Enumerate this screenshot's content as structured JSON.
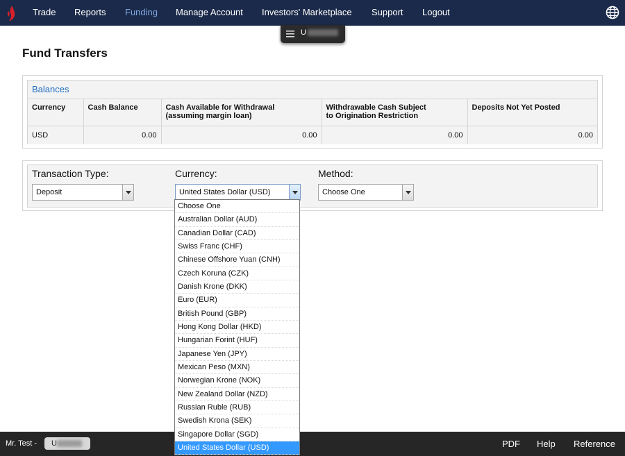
{
  "nav": {
    "items": [
      {
        "label": "Trade"
      },
      {
        "label": "Reports"
      },
      {
        "label": "Funding"
      },
      {
        "label": "Manage Account"
      },
      {
        "label": "Investors' Marketplace"
      },
      {
        "label": "Support"
      },
      {
        "label": "Logout"
      }
    ],
    "active": "Funding",
    "accent": "#7fa7e0",
    "background": "#1b2a4a"
  },
  "account_pill": {
    "prefix": "U"
  },
  "page_title": "Fund Transfers",
  "balances": {
    "title": "Balances",
    "columns": [
      "Currency",
      "Cash Balance",
      "Cash Available for Withdrawal\n(assuming margin loan)",
      "Withdrawable Cash Subject\nto Origination Restriction",
      "Deposits Not Yet Posted"
    ],
    "rows": [
      [
        "USD",
        "0.00",
        "0.00",
        "0.00",
        "0.00"
      ]
    ]
  },
  "transaction": {
    "type_label": "Transaction Type:",
    "type_value": "Deposit",
    "currency_label": "Currency:",
    "currency_value": "United States Dollar (USD)",
    "method_label": "Method:",
    "method_value": "Choose One"
  },
  "currency_options": [
    "Choose One",
    "Australian Dollar (AUD)",
    "Canadian Dollar (CAD)",
    "Swiss Franc (CHF)",
    "Chinese Offshore Yuan (CNH)",
    "Czech Koruna (CZK)",
    "Danish Krone (DKK)",
    "Euro (EUR)",
    "British Pound (GBP)",
    "Hong Kong Dollar (HKD)",
    "Hungarian Forint (HUF)",
    "Japanese Yen (JPY)",
    "Mexican Peso (MXN)",
    "Norwegian Krone (NOK)",
    "New Zealand Dollar (NZD)",
    "Russian Ruble (RUB)",
    "Swedish Krona (SEK)",
    "Singapore Dollar (SGD)",
    "United States Dollar (USD)"
  ],
  "selected_currency_index": 18,
  "footer": {
    "user": "Mr. Test -",
    "account_prefix": "U",
    "links": [
      "PDF",
      "Help",
      "Reference"
    ]
  },
  "icons": {
    "logo": "ib-logo-icon",
    "globe": "globe-icon",
    "menu": "hamburger-icon"
  }
}
